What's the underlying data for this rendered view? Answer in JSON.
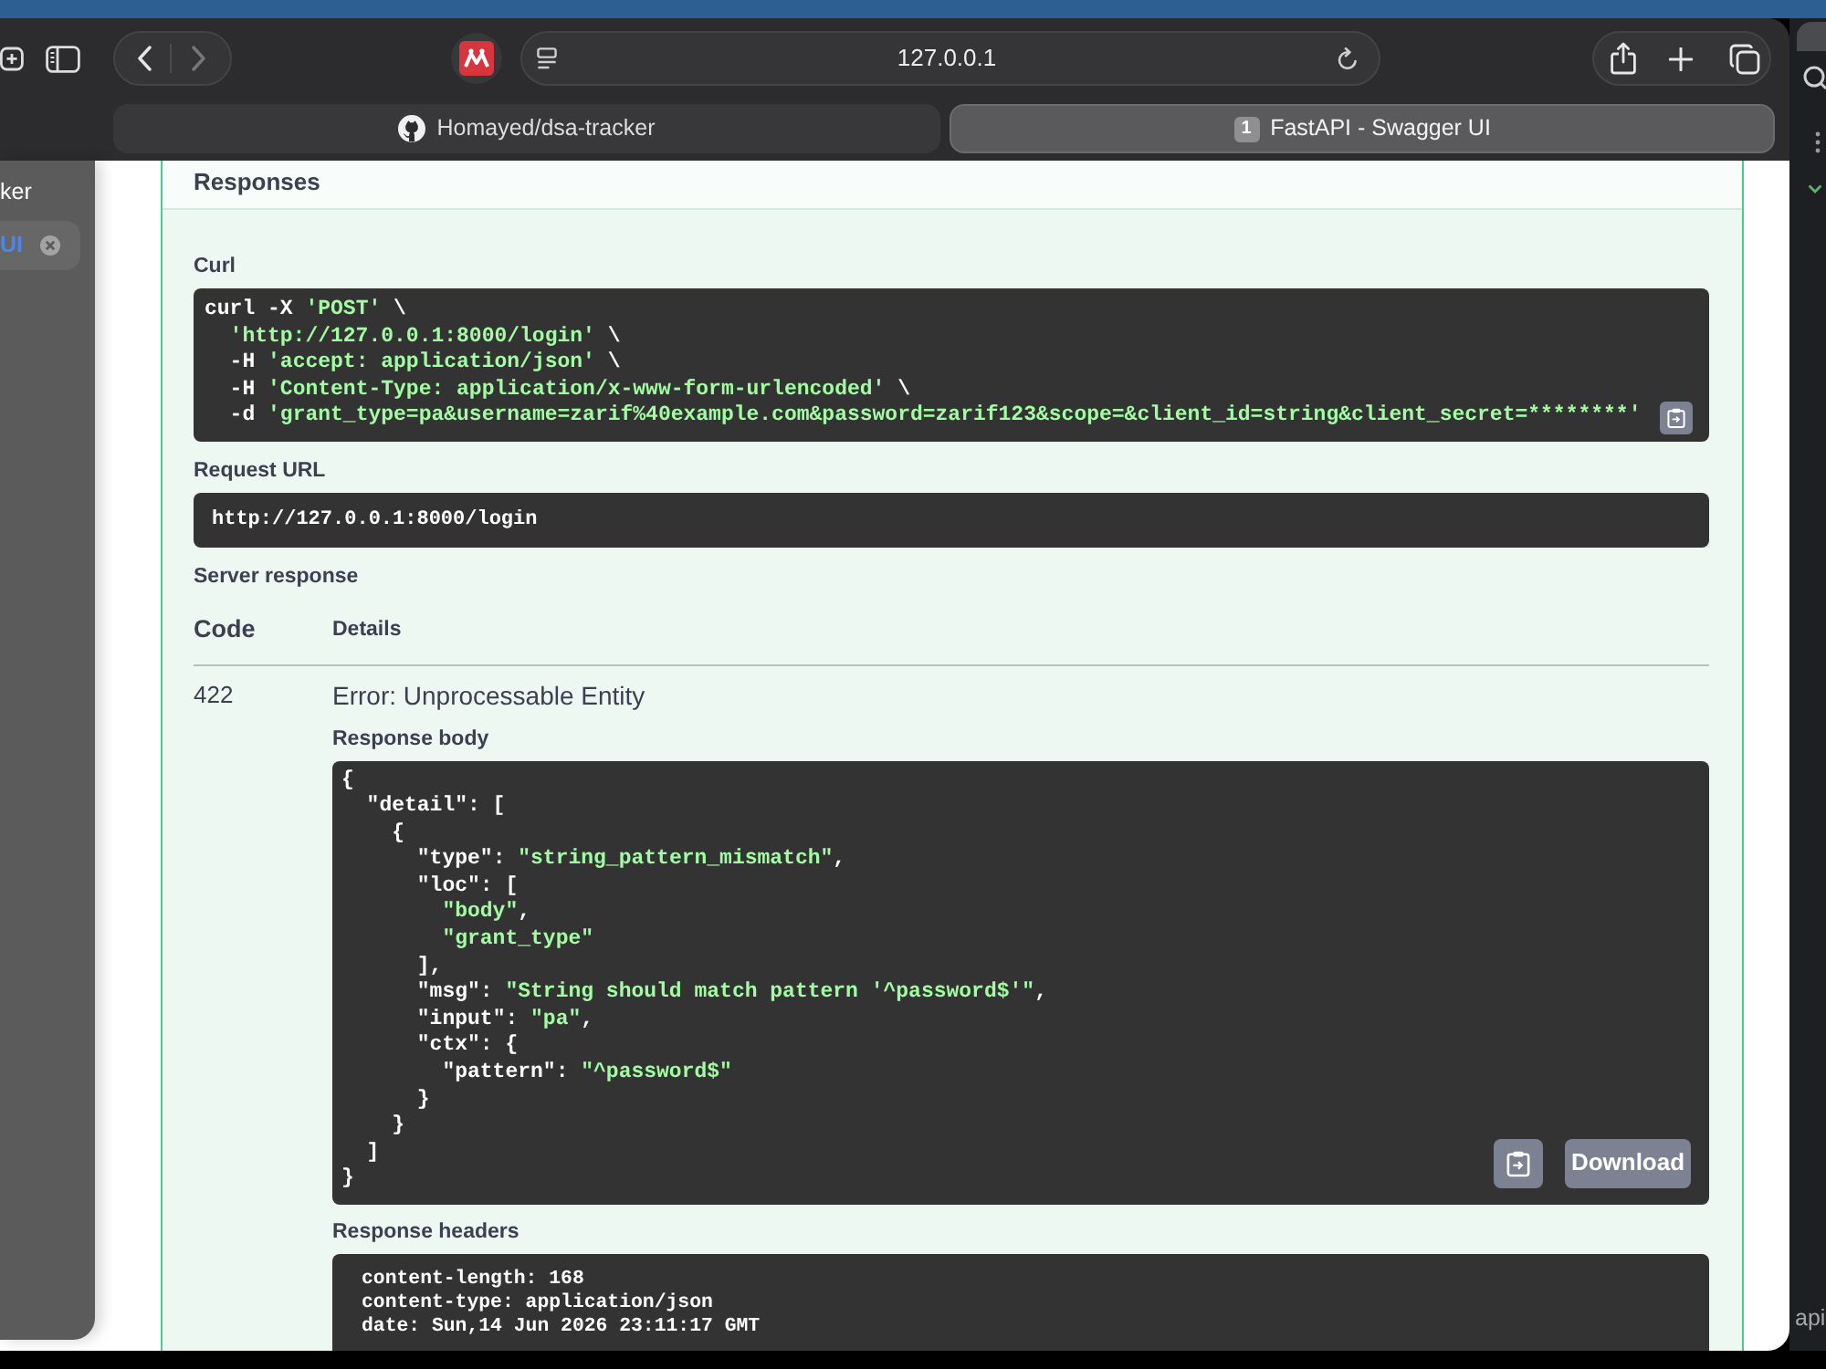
{
  "browser": {
    "toolbar": {
      "back_disabled": false,
      "forward_disabled": true,
      "address": "127.0.0.1"
    },
    "tabs": [
      {
        "title": "Homayed/dsa-tracker",
        "kind": "favicon",
        "selected": false
      },
      {
        "title": "FastAPI - Swagger UI",
        "kind": "numbered",
        "badge": "1",
        "selected": true
      }
    ]
  },
  "sidebar": {
    "items": [
      {
        "label": "ker",
        "selected": false,
        "closable": false
      },
      {
        "label": "UI",
        "selected": true,
        "closable": true
      }
    ]
  },
  "responses": {
    "heading": "Responses",
    "curl": {
      "label": "Curl",
      "lines": [
        [
          {
            "text": "curl -X ",
            "kind": "plain"
          },
          {
            "text": "'POST'",
            "kind": "string"
          },
          {
            "text": " \\",
            "kind": "plain"
          }
        ],
        [
          {
            "text": "  'http://127.0.0.1:8000/login'",
            "kind": "string"
          },
          {
            "text": " \\",
            "kind": "plain"
          }
        ],
        [
          {
            "text": "  -H ",
            "kind": "plain"
          },
          {
            "text": "'accept: application/json'",
            "kind": "string"
          },
          {
            "text": " \\",
            "kind": "plain"
          }
        ],
        [
          {
            "text": "  -H ",
            "kind": "plain"
          },
          {
            "text": "'Content-Type: application/x-www-form-urlencoded'",
            "kind": "string"
          },
          {
            "text": " \\",
            "kind": "plain"
          }
        ],
        [
          {
            "text": "  -d ",
            "kind": "plain"
          },
          {
            "text": "'grant_type=pa&username=zarif%40example.com&password=zarif123&scope=&client_id=string&client_secret=********'",
            "kind": "string"
          }
        ]
      ]
    },
    "request_url": {
      "label": "Request URL",
      "value": "http://127.0.0.1:8000/login"
    },
    "server_response": {
      "label": "Server response",
      "columns": [
        "Code",
        "Details"
      ],
      "code": "422",
      "status": "Error: Unprocessable Entity",
      "response_body": {
        "label": "Response body",
        "download": "Download",
        "lines": [
          [
            {
              "text": "{",
              "kind": "plain"
            }
          ],
          [
            {
              "text": "  \"detail\": [",
              "kind": "plain"
            }
          ],
          [
            {
              "text": "    {",
              "kind": "plain"
            }
          ],
          [
            {
              "text": "      \"type\": ",
              "kind": "plain"
            },
            {
              "text": "\"string_pattern_mismatch\"",
              "kind": "string"
            },
            {
              "text": ",",
              "kind": "plain"
            }
          ],
          [
            {
              "text": "      \"loc\": [",
              "kind": "plain"
            }
          ],
          [
            {
              "text": "        \"body\"",
              "kind": "string"
            },
            {
              "text": ",",
              "kind": "plain"
            }
          ],
          [
            {
              "text": "        \"grant_type\"",
              "kind": "string"
            }
          ],
          [
            {
              "text": "      ],",
              "kind": "plain"
            }
          ],
          [
            {
              "text": "      \"msg\": ",
              "kind": "plain"
            },
            {
              "text": "\"String should match pattern '^password$'\"",
              "kind": "string"
            },
            {
              "text": ",",
              "kind": "plain"
            }
          ],
          [
            {
              "text": "      \"input\": ",
              "kind": "plain"
            },
            {
              "text": "\"pa\"",
              "kind": "string"
            },
            {
              "text": ",",
              "kind": "plain"
            }
          ],
          [
            {
              "text": "      \"ctx\": {",
              "kind": "plain"
            }
          ],
          [
            {
              "text": "        \"pattern\": ",
              "kind": "plain"
            },
            {
              "text": "\"^password$\"",
              "kind": "string"
            }
          ],
          [
            {
              "text": "      }",
              "kind": "plain"
            }
          ],
          [
            {
              "text": "    }",
              "kind": "plain"
            }
          ],
          [
            {
              "text": "  ]",
              "kind": "plain"
            }
          ],
          [
            {
              "text": "}",
              "kind": "plain"
            }
          ]
        ]
      },
      "response_headers": {
        "label": "Response headers",
        "lines": [
          "content-length: 168",
          "content-type: application/json",
          "date: Sun,14 Jun 2026 23:11:17 GMT"
        ]
      }
    }
  },
  "side_window": {
    "label": "api"
  }
}
